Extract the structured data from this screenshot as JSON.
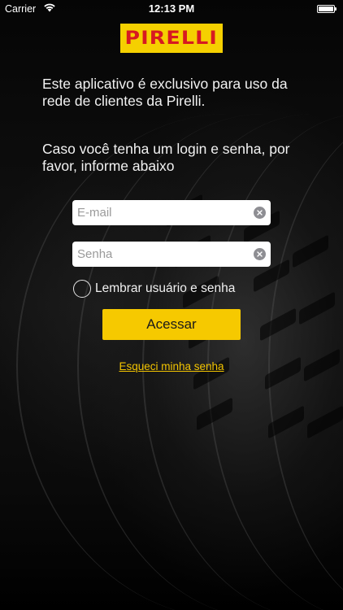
{
  "status_bar": {
    "carrier": "Carrier",
    "time": "12:13 PM",
    "wifi_icon": "wifi-icon",
    "battery_icon": "battery-icon"
  },
  "brand": {
    "logo_text": "PIRELLI",
    "logo_bg": "#f5d000",
    "logo_fg": "#d71921"
  },
  "intro_text": "Este aplicativo é exclusivo para uso da rede de clientes da Pirelli.",
  "prompt_text": "Caso você tenha um login e senha, por favor, informe abaixo",
  "form": {
    "email": {
      "placeholder": "E-mail",
      "value": "",
      "clear_icon": "clear-icon"
    },
    "password": {
      "placeholder": "Senha",
      "value": "",
      "clear_icon": "clear-icon"
    },
    "remember_label": "Lembrar usuário e senha",
    "remember_checked": false,
    "submit_label": "Acessar",
    "forgot_label": "Esqueci minha senha"
  },
  "colors": {
    "accent": "#f6c900",
    "link": "#f3c400",
    "background": "#000000"
  }
}
